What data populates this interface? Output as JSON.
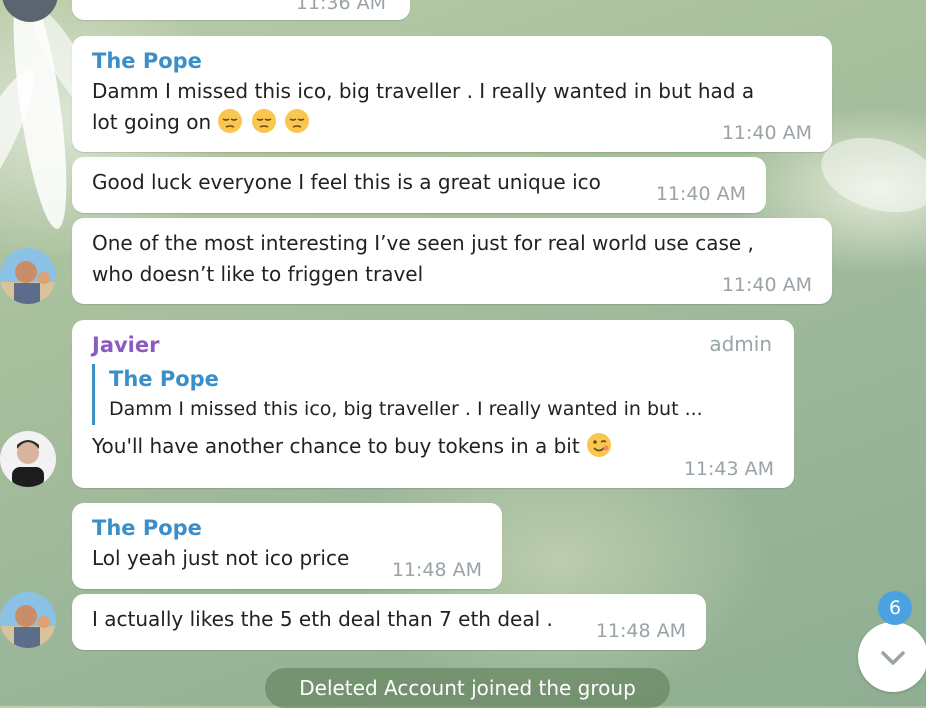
{
  "top_fragment": {
    "time": "11:36 AM"
  },
  "messages": [
    {
      "sender": "The Pope",
      "text_line1": "Damm I missed this ico, big traveller . I really wanted in but had a",
      "text_line2": "lot going on",
      "emoji": "pensive-face x3",
      "time": "11:40 AM"
    },
    {
      "text": "Good luck everyone I feel this is a great unique ico",
      "time": "11:40 AM"
    },
    {
      "text_line1": "One of the most interesting I’ve seen just for real world use case ,",
      "text_line2": "who doesn’t like to friggen travel",
      "time": "11:40 AM"
    },
    {
      "sender": "Javier",
      "role": "admin",
      "reply": {
        "sender": "The Pope",
        "text": "Damm I missed this ico, big traveller . I really wanted in but ..."
      },
      "text": "You'll  have another chance to buy tokens in a bit",
      "emoji": "winking-face",
      "time": "11:43 AM"
    },
    {
      "sender": "The Pope",
      "text": "Lol yeah just not ico price",
      "time": "11:48 AM"
    },
    {
      "text": "I actually likes the 5 eth deal than 7 eth deal .",
      "time": "11:48 AM"
    }
  ],
  "service_message": "Deleted Account joined the group",
  "scroll_down": {
    "unread_count": "6",
    "icon": "chevron-down-icon"
  },
  "colors": {
    "sender_blue": "#3a8fc9",
    "sender_purple": "#8b5bc2",
    "timestamp": "#9aa3a8",
    "badge": "#4aa3e0"
  }
}
